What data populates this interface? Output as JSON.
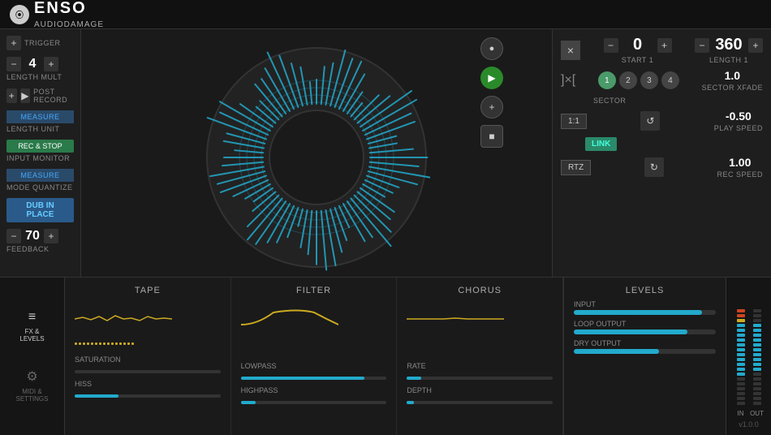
{
  "header": {
    "logo_icon": "⦿",
    "app_name": "ENSO",
    "company": "AUDIODAMAGE"
  },
  "left_controls": {
    "trigger_label": "TRIGGER",
    "trigger_plus": "+",
    "length_mult_label": "LENGTH MULT",
    "length_mult_value": "4",
    "length_mult_minus": "−",
    "length_mult_plus": "+",
    "post_record_label": "POST RECORD",
    "measure_label": "MEASURE",
    "length_unit_label": "LENGTH UNIT",
    "rec_stop_label": "REC & STOP",
    "input_monitor_label": "INPUT MONITOR",
    "mode_quantize_label": "MODE QUANTIZE",
    "measure2_label": "MEASURE",
    "dub_in_place_label": "DUB IN PLACE",
    "feedback_label": "FEEDBACK",
    "feedback_value": "70",
    "feedback_minus": "−",
    "feedback_plus": "+"
  },
  "center": {
    "visualizer_color": "#2ac",
    "play_btn": "▶",
    "stop_btn": "■",
    "record_btn": "●"
  },
  "right_controls": {
    "x_label": "×",
    "start1_label": "START 1",
    "start1_value": "0",
    "start1_minus": "−",
    "start1_plus": "+",
    "length1_label": "LENGTH 1",
    "length1_value": "360",
    "length1_minus": "−",
    "length1_plus": "+",
    "bracket_icon": "]×[",
    "sector_label": "SECTOR",
    "sector_buttons": [
      "1",
      "2",
      "3",
      "4"
    ],
    "sector_xfade_label": "SECTOR XFADE",
    "sector_xfade_value": "1.0",
    "link_label": "LINK",
    "play_speed_label": "PLAY SPEED",
    "play_speed_value": "-0.50",
    "rtz_label": "RTZ",
    "rec_speed_label": "REC SPEED",
    "rec_speed_value": "1.00",
    "one_to_one_label": "1:1"
  },
  "fx_tape": {
    "title": "TAPE",
    "saturation_label": "SATURATION",
    "hiss_label": "HISS",
    "saturation_pct": 0,
    "hiss_pct": 30
  },
  "fx_filter": {
    "title": "FILTER",
    "lowpass_label": "LOWPASS",
    "highpass_label": "HIGHPASS",
    "lowpass_pct": 85,
    "highpass_pct": 10
  },
  "fx_chorus": {
    "title": "CHORUS",
    "rate_label": "RATE",
    "depth_label": "DEPTH",
    "rate_pct": 10,
    "depth_pct": 5
  },
  "fx_levels": {
    "title": "LEVELS",
    "input_label": "INPUT",
    "loop_output_label": "LOOP OUTPUT",
    "dry_output_label": "DRY OUTPUT",
    "input_pct": 90,
    "loop_output_pct": 80,
    "dry_output_pct": 60
  },
  "bottom_sidebar": {
    "fx_levels_label": "FX &\nLEVELS",
    "midi_settings_label": "MIDI &\nSETTINGS"
  },
  "vu": {
    "in_label": "IN",
    "out_label": "OUT",
    "version": "v1.0.0"
  }
}
